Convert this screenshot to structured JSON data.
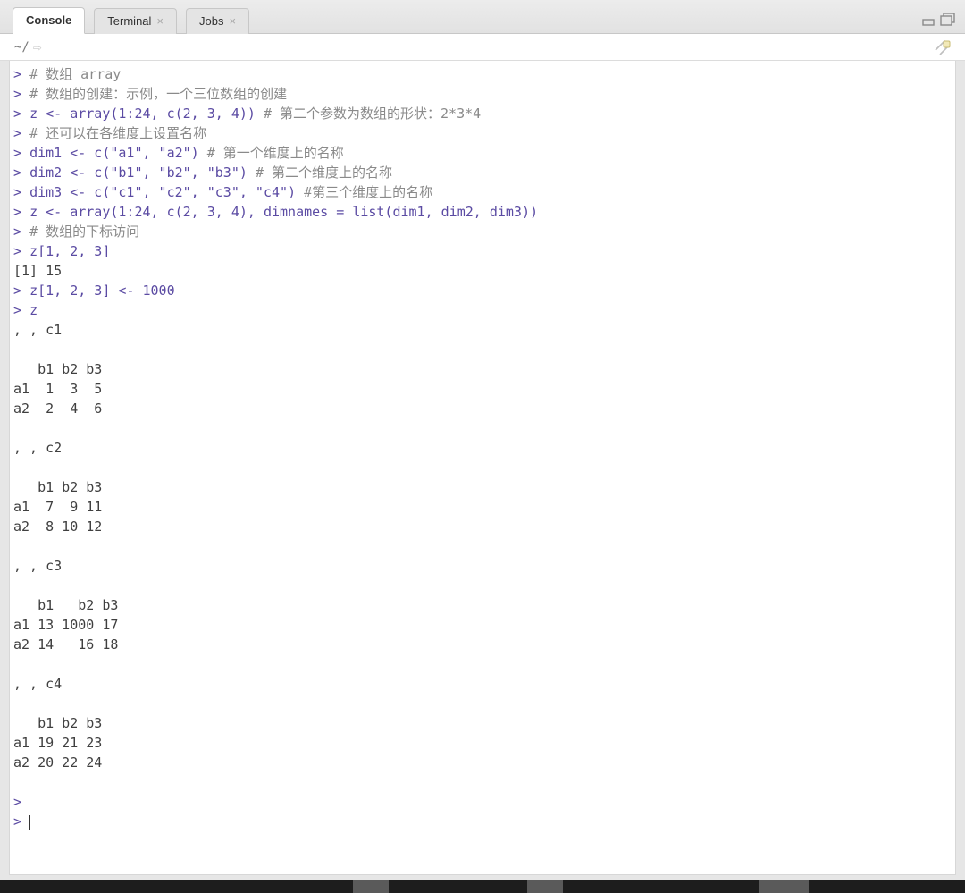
{
  "tabs": {
    "console": "Console",
    "terminal": "Terminal",
    "jobs": "Jobs"
  },
  "path": {
    "wd": "~/"
  },
  "lines": [
    {
      "kind": "cmd",
      "prefix": "> ",
      "code": "",
      "comment": "# 数组 array"
    },
    {
      "kind": "cmd",
      "prefix": "> ",
      "code": "",
      "comment": "# 数组的创建：示例，一个三位数组的创建"
    },
    {
      "kind": "cmd",
      "prefix": "> ",
      "code": "z <- array(1:24, c(2, 3, 4)) ",
      "comment": "# 第二个参数为数组的形状：2*3*4"
    },
    {
      "kind": "cmd",
      "prefix": "> ",
      "code": "",
      "comment": "# 还可以在各维度上设置名称"
    },
    {
      "kind": "cmd",
      "prefix": "> ",
      "code": "dim1 <- c(\"a1\", \"a2\") ",
      "comment": "# 第一个维度上的名称"
    },
    {
      "kind": "cmd",
      "prefix": "> ",
      "code": "dim2 <- c(\"b1\", \"b2\", \"b3\") ",
      "comment": "# 第二个维度上的名称"
    },
    {
      "kind": "cmd",
      "prefix": "> ",
      "code": "dim3 <- c(\"c1\", \"c2\", \"c3\", \"c4\") ",
      "comment": "#第三个维度上的名称"
    },
    {
      "kind": "cmd",
      "prefix": "> ",
      "code": "z <- array(1:24, c(2, 3, 4), dimnames = list(dim1, dim2, dim3))",
      "comment": ""
    },
    {
      "kind": "cmd",
      "prefix": "> ",
      "code": "",
      "comment": "# 数组的下标访问"
    },
    {
      "kind": "cmd",
      "prefix": "> ",
      "code": "z[1, 2, 3]",
      "comment": ""
    },
    {
      "kind": "out",
      "text": "[1] 15"
    },
    {
      "kind": "cmd",
      "prefix": "> ",
      "code": "z[1, 2, 3] <- 1000",
      "comment": ""
    },
    {
      "kind": "cmd",
      "prefix": "> ",
      "code": "z",
      "comment": ""
    },
    {
      "kind": "out",
      "text": ", , c1"
    },
    {
      "kind": "out",
      "text": ""
    },
    {
      "kind": "out",
      "text": "   b1 b2 b3"
    },
    {
      "kind": "out",
      "text": "a1  1  3  5"
    },
    {
      "kind": "out",
      "text": "a2  2  4  6"
    },
    {
      "kind": "out",
      "text": ""
    },
    {
      "kind": "out",
      "text": ", , c2"
    },
    {
      "kind": "out",
      "text": ""
    },
    {
      "kind": "out",
      "text": "   b1 b2 b3"
    },
    {
      "kind": "out",
      "text": "a1  7  9 11"
    },
    {
      "kind": "out",
      "text": "a2  8 10 12"
    },
    {
      "kind": "out",
      "text": ""
    },
    {
      "kind": "out",
      "text": ", , c3"
    },
    {
      "kind": "out",
      "text": ""
    },
    {
      "kind": "out",
      "text": "   b1   b2 b3"
    },
    {
      "kind": "out",
      "text": "a1 13 1000 17"
    },
    {
      "kind": "out",
      "text": "a2 14   16 18"
    },
    {
      "kind": "out",
      "text": ""
    },
    {
      "kind": "out",
      "text": ", , c4"
    },
    {
      "kind": "out",
      "text": ""
    },
    {
      "kind": "out",
      "text": "   b1 b2 b3"
    },
    {
      "kind": "out",
      "text": "a1 19 21 23"
    },
    {
      "kind": "out",
      "text": "a2 20 22 24"
    },
    {
      "kind": "out",
      "text": ""
    },
    {
      "kind": "cmd",
      "prefix": "> ",
      "code": "",
      "comment": ""
    },
    {
      "kind": "prompt",
      "prefix": "> "
    }
  ]
}
